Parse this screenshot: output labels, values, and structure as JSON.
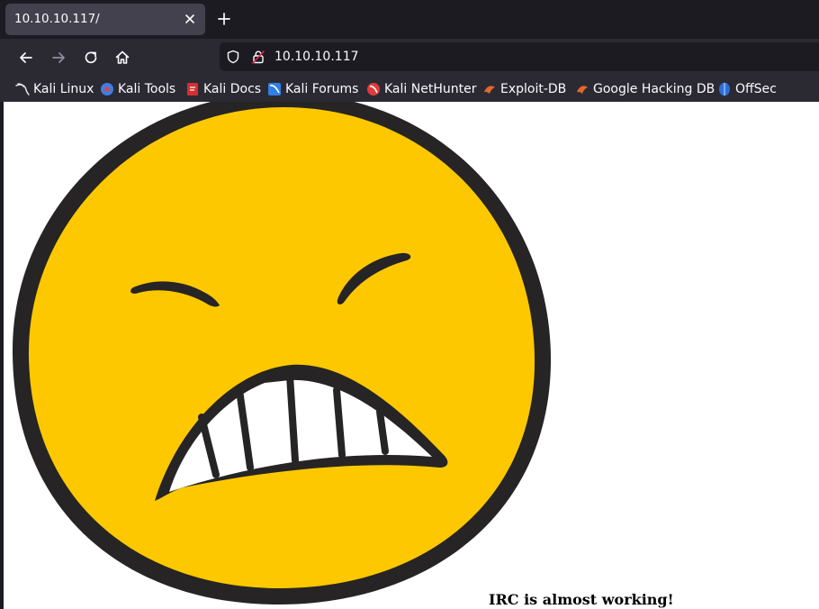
{
  "tab": {
    "title": "10.10.10.117/"
  },
  "navbar": {
    "url": "10.10.10.117"
  },
  "bookmarks": [
    {
      "label": "Kali Linux",
      "icon": "kali-linux-icon"
    },
    {
      "label": "Kali Tools",
      "icon": "kali-tools-icon"
    },
    {
      "label": "Kali Docs",
      "icon": "kali-docs-icon"
    },
    {
      "label": "Kali Forums",
      "icon": "kali-forums-icon"
    },
    {
      "label": "Kali NetHunter",
      "icon": "kali-nethunter-icon"
    },
    {
      "label": "Exploit-DB",
      "icon": "exploit-db-icon"
    },
    {
      "label": "Google Hacking DB",
      "icon": "google-hacking-db-icon"
    },
    {
      "label": "OffSec",
      "icon": "offsec-icon"
    }
  ],
  "page": {
    "caption": "IRC is almost working!",
    "image": {
      "subject": "angry-smiley-face"
    }
  },
  "colors": {
    "tab_active": "#42414d",
    "toolbar": "#2b2a33",
    "urlbar": "#1c1b22",
    "smiley_face": "#fdc800",
    "smiley_outline": "#262424"
  }
}
